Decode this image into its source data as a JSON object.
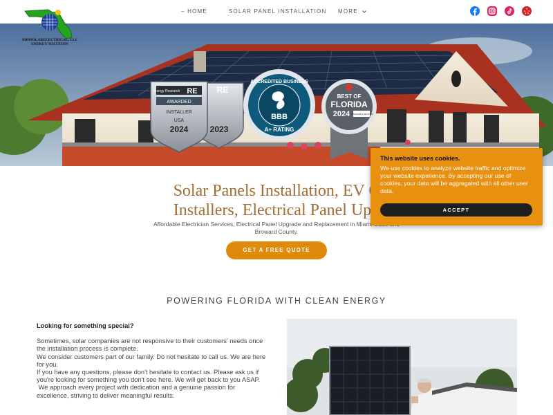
{
  "brand": {
    "logo_text": "ADDSOLARELECTRICAL, LLC",
    "logo_tagline": "ENERGY SOLUTION"
  },
  "nav": {
    "home": "– HOME",
    "solar": "SOLAR PANEL INSTALLATION",
    "more": "MORE"
  },
  "social": [
    "facebook-icon",
    "instagram-icon",
    "tiktok-icon",
    "yelp-icon"
  ],
  "colors": {
    "accent": "#e08a0c",
    "heading": "#a26c34",
    "cookie_bg": "#e8900f"
  },
  "badges": {
    "award_top": "Energy Research",
    "award_awarded": "AWARDED",
    "award_installer": "INSTALLER",
    "award_usa": "USA",
    "award_year": "2024",
    "award_year_back": "2023",
    "bbb_ring": "ACCREDITED BUSINESS",
    "bbb_logo": "BBB",
    "bbb_rating": "A+ RATING",
    "florida_best": "BEST OF",
    "florida_state": "FLORIDA",
    "florida_year": "2024",
    "florida_note": "HONORABLE MENTION"
  },
  "hero": {
    "headline_1": "Solar Panels Installation, EV C",
    "headline_2": "Installers, Electrical Panel Upg",
    "subline_1": "Affordable Electrician Services, Electrical Panel Upgrade and Replacement in Miami-Dade and",
    "subline_2": "Broward County.",
    "cta": "GET A FREE QUOTE"
  },
  "section": {
    "title": "POWERING FLORIDA WITH CLEAN ENERGY",
    "question": "Looking for something special?",
    "p1": "Sometimes, solar companies are not responsive to their customers' needs once the installation process is complete.",
    "p2": "We consider customers part of our family. Do not hesitate to call us. We are here for you.",
    "p3": "If you have any questions, please don't hesitate to contact us. Please ask us if you're looking for something you don't see here. We will get back to you ASAP.",
    "p4": " We approach every project with dedication and a genuine passion for excellence, striving to deliver meaningful results."
  },
  "cookie": {
    "title": "This website uses cookies.",
    "body": "We use cookies to analyze website traffic and optimize your website experience. By accepting our use of cookies, your data will be aggregated with all other user data.",
    "accept": "ACCEPT"
  }
}
